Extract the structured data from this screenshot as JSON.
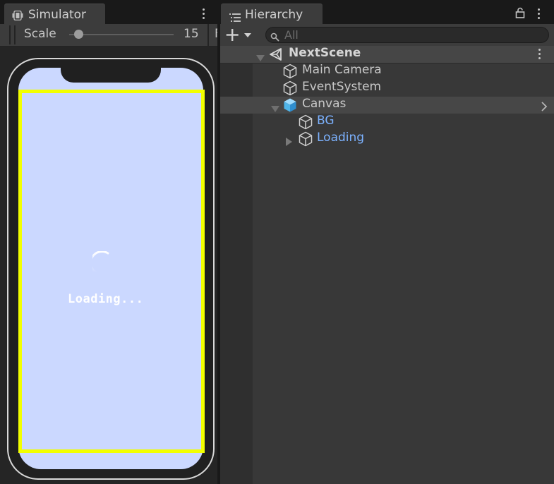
{
  "simulator": {
    "tab_label": "Simulator",
    "tab_icon": "device-icon",
    "scale_label": "Scale",
    "scale_value": "15",
    "scale_fraction": 0.06,
    "toolbar_truncated_text": "F",
    "game": {
      "loading_text": "Loading...",
      "screen_color": "#cbd8ff",
      "safe_area_color": "#f2ff00"
    }
  },
  "hierarchy": {
    "tab_label": "Hierarchy",
    "tab_icon": "hierarchy-list-icon",
    "search": {
      "placeholder": "All",
      "value": ""
    },
    "scene": {
      "name": "NextScene",
      "expanded": true
    },
    "items": [
      {
        "label": "Main Camera",
        "icon": "gameobject-cube-icon",
        "prefab": false
      },
      {
        "label": "EventSystem",
        "icon": "gameobject-cube-icon",
        "prefab": false
      },
      {
        "label": "Canvas",
        "icon": "gameobject-cube-icon",
        "prefab": false,
        "expanded": true,
        "selected_highlight": true
      },
      {
        "label": "BG",
        "icon": "gameobject-cube-icon",
        "prefab": true
      },
      {
        "label": "Loading",
        "icon": "gameobject-cube-icon",
        "prefab": true,
        "expanded": false
      }
    ],
    "prefab_text_color": "#7cb2ff",
    "canvas_icon_color": "#5fc0f0"
  }
}
